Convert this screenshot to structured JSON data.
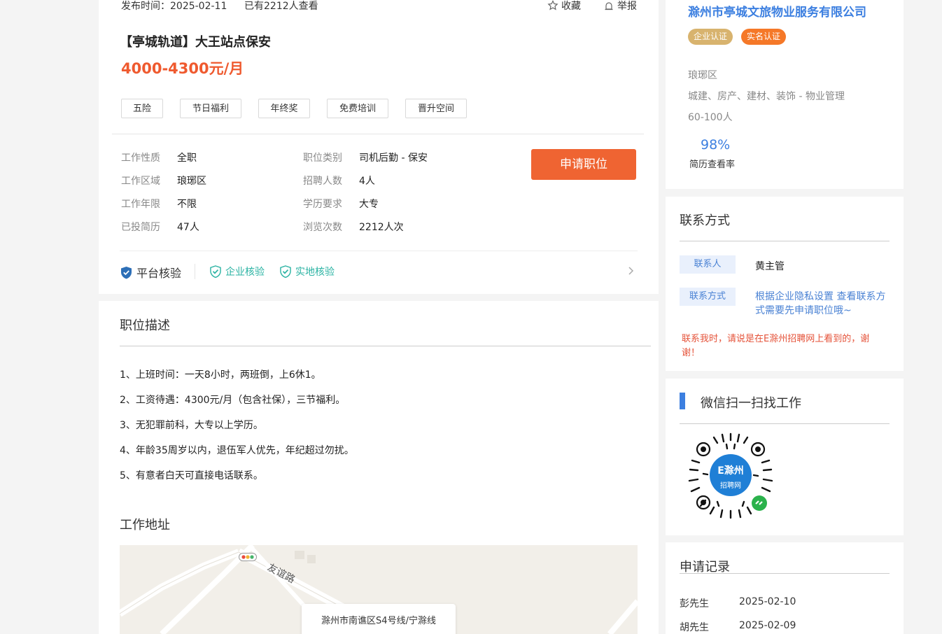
{
  "job": {
    "publish_date": "发布时间：2025-02-11",
    "views_text": "已有2212人查看",
    "favorite_label": "收藏",
    "report_label": "举报",
    "title": "【亭城轨道】大王站点保安",
    "salary": "4000-4300元/月",
    "tags": [
      "五险",
      "节日福利",
      "年终奖",
      "免费培训",
      "晋升空间"
    ],
    "apply_label": "申请职位",
    "details": {
      "nature_key": "工作性质",
      "nature_value": "全职",
      "area_key": "工作区域",
      "area_value": "琅琊区",
      "years_key": "工作年限",
      "years_value": "不限",
      "applied_key": "已投简历",
      "applied_value": "47人",
      "category_key": "职位类别",
      "category_value": "司机后勤 - 保安",
      "headcount_key": "招聘人数",
      "headcount_value": "4人",
      "education_key": "学历要求",
      "education_value": "大专",
      "browse_key": "浏览次数",
      "browse_value": "2212人次"
    },
    "verify": {
      "platform": "平台核验",
      "company": "企业核验",
      "site": "实地核验"
    }
  },
  "description": {
    "title": "职位描述",
    "lines": [
      "1、上班时间：一天8小时，两班倒，上6休1。",
      "2、工资待遇：4300元/月（包含社保），三节福利。",
      "3、无犯罪前科，大专以上学历。",
      "4、年龄35周岁以内，退伍军人优先，年纪超过勿扰。",
      "5、有意者白天可直接电话联系。"
    ]
  },
  "address": {
    "title": "工作地址",
    "road_label": "友谊路",
    "location": "滁州市南谯区S4号线/宁滁线"
  },
  "company": {
    "name": "滁州市亭城文旅物业服务有限公司",
    "badge_enterprise": "企业认证",
    "badge_realname": "实名认证",
    "district": "琅琊区",
    "industry": "城建、房产、建材、装饰 - 物业管理",
    "size": "60-100人",
    "view_rate": "98%",
    "view_rate_label": "简历查看率"
  },
  "contact": {
    "title": "联系方式",
    "person_key": "联系人",
    "person_value": "黄主管",
    "method_key": "联系方式",
    "method_value_1": "根据企业隐私设置 查看联系方",
    "method_value_2": "式需要先申请职位哦~",
    "notice_1": "联系我时，请说是在E滁州招聘网上看到的，谢",
    "notice_2": "谢！"
  },
  "wechat": {
    "title": "微信扫一扫找工作",
    "qr_brand": "E滁州",
    "qr_sub": "招聘网"
  },
  "records": {
    "title": "申请记录",
    "items": [
      {
        "name": "彭先生",
        "date": "2025-02-10"
      },
      {
        "name": "胡先生",
        "date": "2025-02-09"
      }
    ]
  },
  "colors": {
    "accent_orange": "#ef6432",
    "salary_orange": "#ef5a2f",
    "brand_blue": "#3c7fe0",
    "verify_teal": "#2bb3a3"
  }
}
